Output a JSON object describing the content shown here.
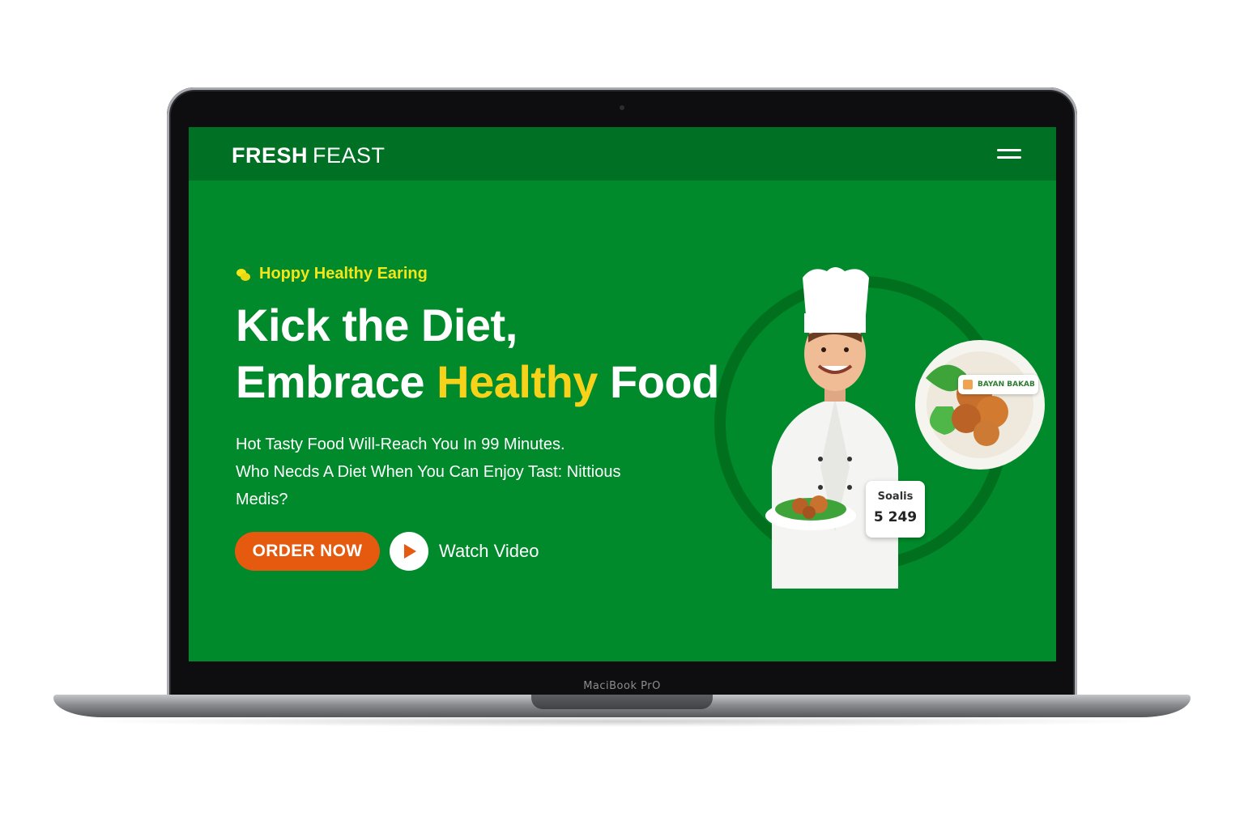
{
  "device": {
    "label": "MaciBook PrO"
  },
  "navbar": {
    "brand_bold": "FRESH",
    "brand_light": "FEAST",
    "menu_icon": "hamburger-menu-icon"
  },
  "hero": {
    "tagline": "Hoppy Healthy Earing",
    "tagline_icon": "lemon-icon",
    "headline_line1": "Kick the Diet,",
    "headline_line2_pre": "Embrace",
    "headline_line2_highlight": "Healthy",
    "headline_line2_post": "Food",
    "description_line1": "Hot Tasty Food Will-Reach You In 99 Minutes.",
    "description_line2": "Who Necds A Diet When You Can Enjoy Tast: Nittious",
    "description_line3": "Medis?",
    "order_button": "ORDER NOW",
    "watch_label": "Watch Video",
    "play_icon": "play-icon"
  },
  "cards": {
    "price_title": "Soalis",
    "price_value": "5 249",
    "dish_tag": "BAYAN BAKAB"
  },
  "colors": {
    "screen_bg": "#008a2b",
    "navbar_bg": "#007024",
    "accent_yellow": "#f6d21a",
    "order_orange": "#e65a10"
  }
}
